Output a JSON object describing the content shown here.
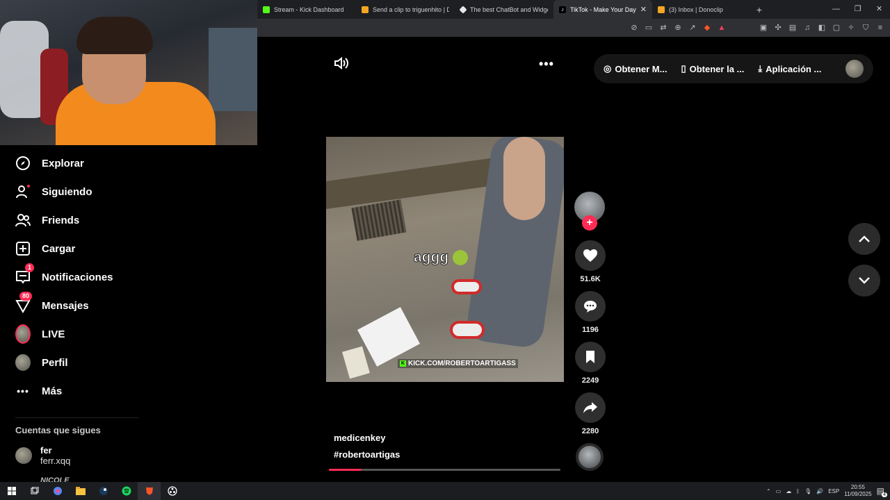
{
  "browser": {
    "tabs": [
      {
        "label": "Stream - Kick Dashboard",
        "favicon_color": "#53fc18",
        "active": false
      },
      {
        "label": "Send a clip to triguenhito | Do",
        "favicon_color": "#f4a623",
        "active": false
      },
      {
        "label": "The best ChatBot and Widgets",
        "favicon_color": "#e8e8e8",
        "active": false
      },
      {
        "label": "TikTok - Make Your Day",
        "favicon_color": "#ffffff",
        "active": true
      },
      {
        "label": "(3) Inbox | Donoclip",
        "favicon_color": "#f4a623",
        "active": false
      }
    ],
    "new_tab": "+",
    "window_controls": [
      "—",
      "❐",
      "✕"
    ],
    "close_tab": "✕"
  },
  "sidebar": {
    "items": [
      {
        "label": "Explorar",
        "icon": "compass-icon"
      },
      {
        "label": "Siguiendo",
        "icon": "user-following-icon"
      },
      {
        "label": "Friends",
        "icon": "friends-icon"
      },
      {
        "label": "Cargar",
        "icon": "upload-icon"
      },
      {
        "label": "Notificaciones",
        "icon": "inbox-icon",
        "badge": "1"
      },
      {
        "label": "Mensajes",
        "icon": "send-icon",
        "badge": "80"
      },
      {
        "label": "LIVE",
        "icon": "live-avatar-icon"
      },
      {
        "label": "Perfil",
        "icon": "profile-avatar-icon"
      },
      {
        "label": "Más",
        "icon": "more-icon"
      }
    ],
    "following_title": "Cuentas que sigues",
    "following": [
      {
        "name": "fer",
        "username": "ferr.xqq"
      },
      {
        "name": "NICOLE"
      }
    ]
  },
  "header": {
    "pill": [
      {
        "label": "Obtener M...",
        "icon": "coin-icon"
      },
      {
        "label": "Obtener la ...",
        "icon": "phone-icon"
      },
      {
        "label": "Aplicación ...",
        "icon": "download-icon"
      }
    ]
  },
  "video": {
    "caption": "aggg",
    "watermark": "KICK.COM/ROBERTOARTIGASS",
    "author": "medicenkey",
    "hashtag": "#robertoartigas",
    "progress": 0.14
  },
  "actions": {
    "likes": "51.6K",
    "comments": "1196",
    "saves": "2249",
    "shares": "2280"
  },
  "taskbar": {
    "language": "ESP",
    "time": "20:55",
    "date": "11/09/2025",
    "notifications": "4"
  },
  "colors": {
    "accent": "#fe2c55",
    "kick": "#53fc18"
  }
}
